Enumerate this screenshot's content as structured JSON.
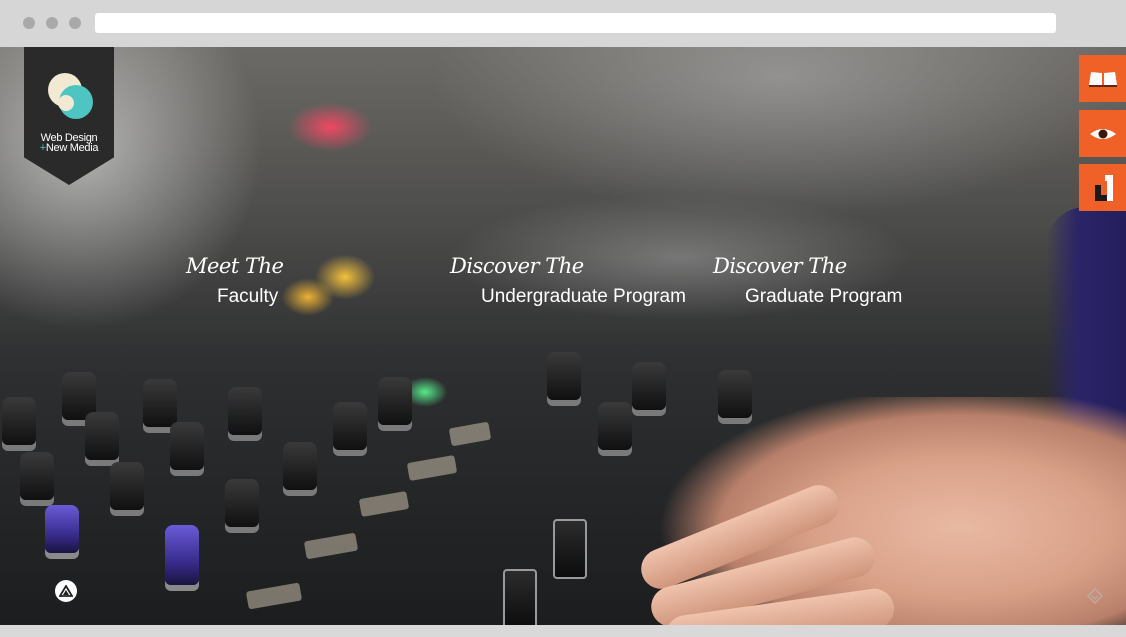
{
  "logo": {
    "line1": "Web Design",
    "plus": "+",
    "line2": "New Media",
    "colors": {
      "badge": "#2a2a2a",
      "teal": "#4ec4c3",
      "cream": "#f1e9d2"
    }
  },
  "nav": [
    {
      "prefix": "Meet The",
      "label": "Faculty"
    },
    {
      "prefix": "Discover The",
      "label": "Undergraduate Program"
    },
    {
      "prefix": "Discover The",
      "label": "Graduate Program"
    }
  ],
  "side_buttons": [
    {
      "icon": "book-icon"
    },
    {
      "icon": "eye-icon"
    },
    {
      "icon": "bracket-logo-icon"
    }
  ],
  "accent_color": "#f06128",
  "corner_icon": "triangle-logo-icon",
  "scroll_icon": "scroll-indicator-icon"
}
